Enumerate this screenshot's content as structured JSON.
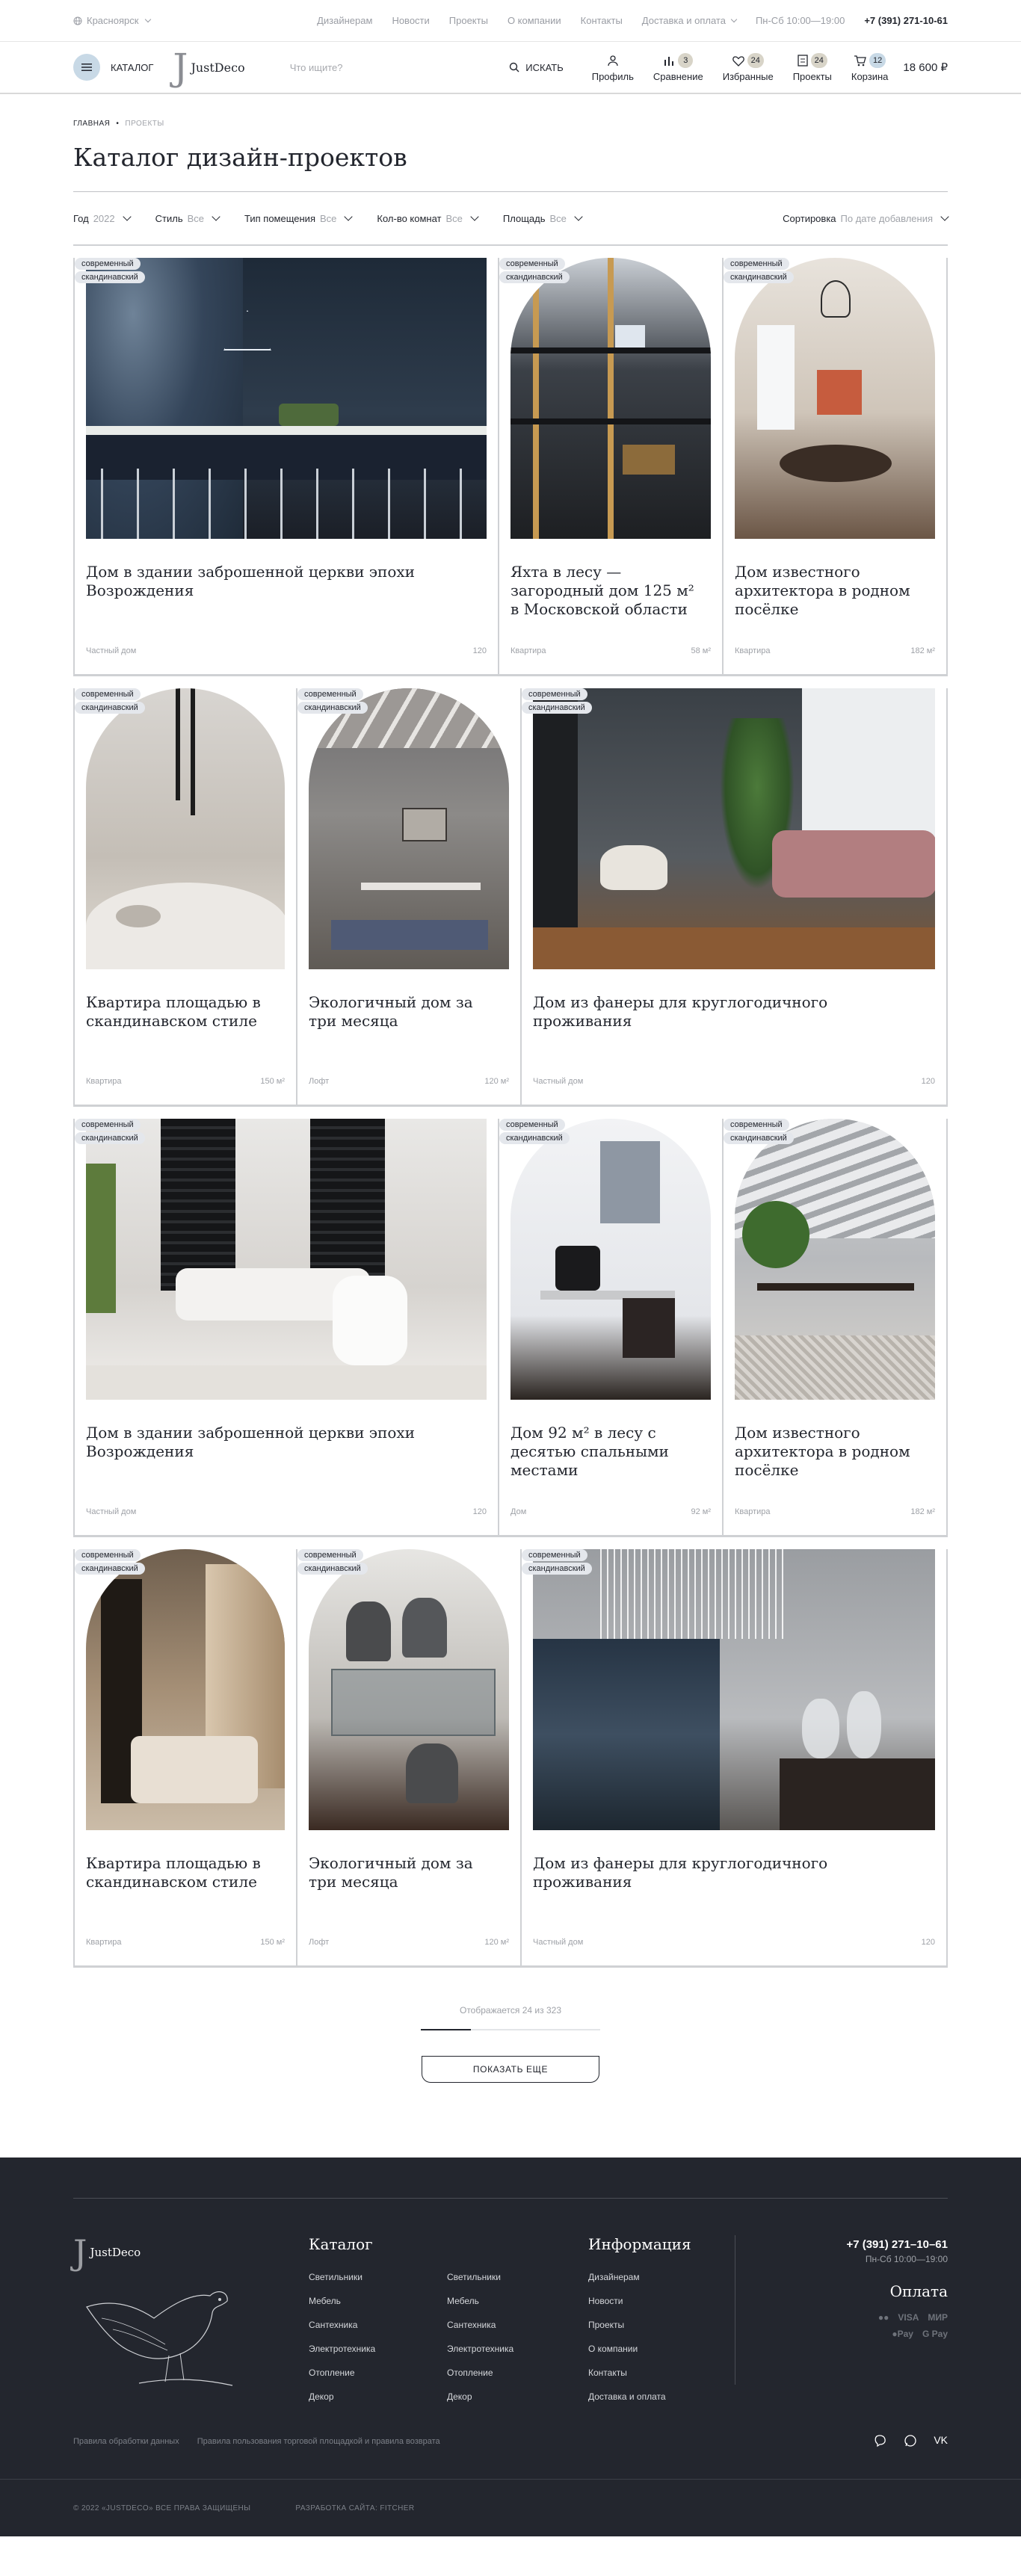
{
  "topbar": {
    "city": "Красноярск",
    "links": [
      "Дизайнерам",
      "Новости",
      "Проекты",
      "О компании",
      "Контакты",
      "Доставка и оплата"
    ],
    "hours": "Пн-Сб 10:00—19:00",
    "phone": "+7 (391) 271-10-61"
  },
  "header": {
    "catalog_label": "КАТАЛОГ",
    "logo_text": "JustDeco",
    "search_placeholder": "Что ищите?",
    "search_button": "ИСКАТЬ",
    "profile": "Профиль",
    "compare": "Сравнение",
    "compare_count": "3",
    "favorites": "Избранные",
    "favorites_count": "24",
    "projects": "Проекты",
    "projects_count": "24",
    "cart": "Корзина",
    "cart_count": "12",
    "cart_total": "18 600 ₽"
  },
  "breadcrumb": {
    "home": "ГЛАВНАЯ",
    "current": "ПРОЕКТЫ"
  },
  "page_title": "Каталог дизайн-проектов",
  "filters": {
    "year_label": "Год",
    "year_value": "2022",
    "style_label": "Стиль",
    "style_value": "Все",
    "room_label": "Тип помещения",
    "room_value": "Все",
    "rooms_label": "Кол-во комнат",
    "rooms_value": "Все",
    "area_label": "Площадь",
    "area_value": "Все",
    "sort_label": "Сортировка",
    "sort_value": "По дате добавления"
  },
  "tags": {
    "a": "современный",
    "b": "скандинавский"
  },
  "cards": [
    {
      "title": "Дом в здании заброшенной церкви эпохи Возрождения",
      "type": "Частный дом",
      "area": "120"
    },
    {
      "title": "Яхта в лесу — загородный дом 125 м² в Московской области",
      "type": "Квартира",
      "area": "58 м²"
    },
    {
      "title": "Дом известного архитектора в родном посёлке",
      "type": "Квартира",
      "area": "182 м²"
    },
    {
      "title": "Квартира площадью в скандинавском стиле",
      "type": "Квартира",
      "area": "150 м²"
    },
    {
      "title": "Экологичный дом за три месяца",
      "type": "Лофт",
      "area": "120 м²"
    },
    {
      "title": "Дом из фанеры для круглогодичного проживания",
      "type": "Частный дом",
      "area": "120"
    },
    {
      "title": "Дом в здании заброшенной церкви эпохи Возрождения",
      "type": "Частный дом",
      "area": "120"
    },
    {
      "title": "Дом 92 м² в лесу с десятью спальными местами",
      "type": "Дом",
      "area": "92 м²"
    },
    {
      "title": "Дом известного архитектора в родном посёлке",
      "type": "Квартира",
      "area": "182 м²"
    },
    {
      "title": "Квартира площадью в скандинавском стиле",
      "type": "Квартира",
      "area": "150 м²"
    },
    {
      "title": "Экологичный дом за три месяца",
      "type": "Лофт",
      "area": "120 м²"
    },
    {
      "title": "Дом из фанеры для круглогодичного проживания",
      "type": "Частный дом",
      "area": "120"
    }
  ],
  "pagination": {
    "counter": "Отображается 24 из 323",
    "progress": 0.28,
    "more_button": "ПОКАЗАТЬ ЕЩЕ"
  },
  "footer": {
    "logo_text": "JustDeco",
    "catalog_head": "Каталог",
    "catalog_col1": [
      "Светильники",
      "Мебель",
      "Сантехника",
      "Электротехника",
      "Отопление",
      "Декор"
    ],
    "catalog_col2": [
      "Светильники",
      "Мебель",
      "Сантехника",
      "Электротехника",
      "Отопление",
      "Декор"
    ],
    "info_head": "Информация",
    "info_items": [
      "Дизайнерам",
      "Новости",
      "Проекты",
      "О компании",
      "Контакты",
      "Доставка и оплата"
    ],
    "phone": "+7 (391) 271–10–61",
    "hours": "Пн-Сб 10:00—19:00",
    "pay_head": "Оплата",
    "pay_row1": [
      "VISA",
      "МИР"
    ],
    "pay_row2": [
      "Pay",
      "G Pay"
    ],
    "legal1": "Правила обработки данных",
    "legal2": "Правила пользования торговой площадкой и правила возврата",
    "copyright": "© 2022 «JUSTDECO» ВСЕ ПРАВА ЗАЩИЩЕНЫ",
    "dev": "РАЗРАБОТКА САЙТА: FITCHER",
    "social_vk": "VK"
  }
}
